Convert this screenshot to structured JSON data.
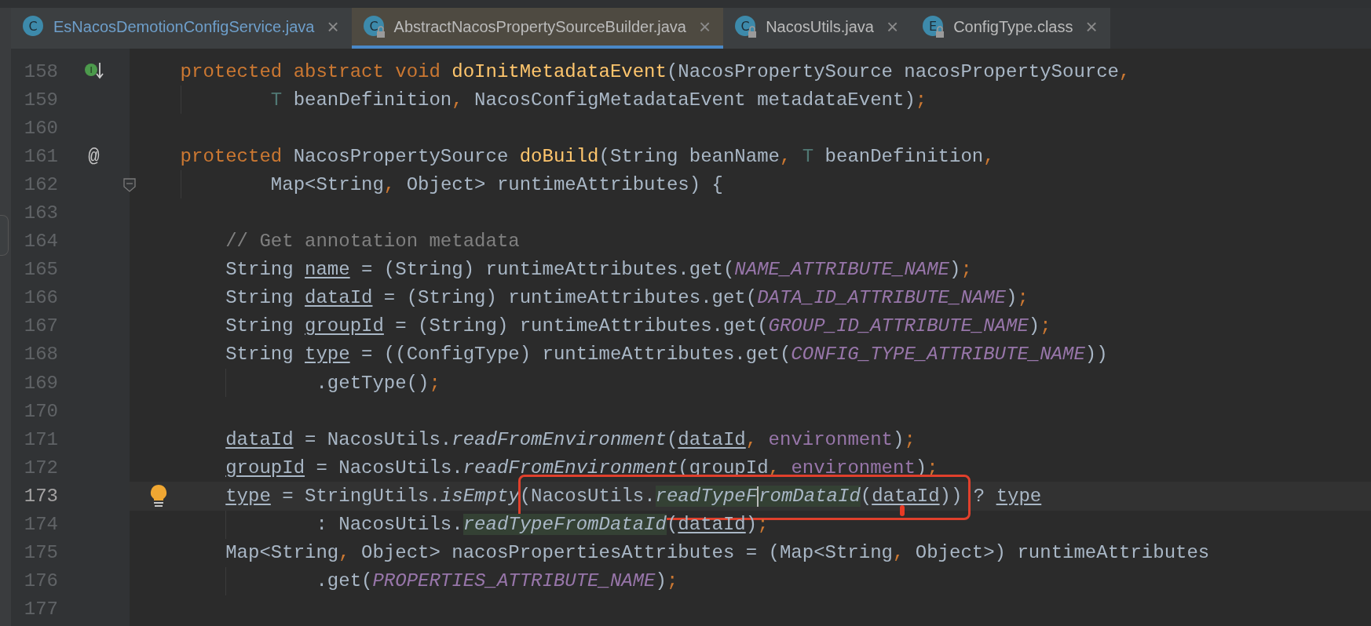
{
  "tabs": [
    {
      "icon_letter": "C",
      "label": "EsNacosDemotionConfigService.java",
      "close": "×",
      "locked": false,
      "selected": false,
      "color": "#6e9fcb"
    },
    {
      "icon_letter": "C",
      "label": "AbstractNacosPropertySourceBuilder.java",
      "close": "×",
      "locked": true,
      "selected": true,
      "color": "#bbbbbb"
    },
    {
      "icon_letter": "C",
      "label": "NacosUtils.java",
      "close": "×",
      "locked": true,
      "selected": false,
      "color": "#bbbbbb"
    },
    {
      "icon_letter": "E",
      "label": "ConfigType.class",
      "close": "×",
      "locked": true,
      "selected": false,
      "color": "#bbbbbb"
    }
  ],
  "lines": [
    {
      "number": "158",
      "current": false,
      "annotated": false,
      "kind": "member",
      "gutter": {
        "kind": "implements",
        "letter": "I"
      },
      "tokens": [
        {
          "t": "protected abstract void ",
          "kind": "kw"
        },
        {
          "t": "doInitMetadataEvent",
          "kind": "fn"
        },
        {
          "t": "(NacosPropertySource nacosPropertySource",
          "kind": "plain"
        },
        {
          "t": ",",
          "kind": "punct"
        }
      ]
    },
    {
      "number": "159",
      "current": false,
      "annotated": false,
      "kind": "member_wrap",
      "tokens": [
        {
          "t": "T",
          "kind": "tparam"
        },
        {
          "t": " beanDefinition",
          "kind": "plain"
        },
        {
          "t": ", ",
          "kind": "punct"
        },
        {
          "t": "NacosConfigMetadataEvent metadataEvent)",
          "kind": "plain"
        },
        {
          "t": ";",
          "kind": "punct"
        }
      ]
    },
    {
      "number": "160",
      "current": false,
      "annotated": false,
      "kind": "blank"
    },
    {
      "number": "161",
      "current": false,
      "annotated": false,
      "kind": "member",
      "gutter": {
        "kind": "annotation",
        "symbol": "@"
      },
      "tokens": [
        {
          "t": "protected ",
          "kind": "kw"
        },
        {
          "t": "NacosPropertySource ",
          "kind": "plain"
        },
        {
          "t": "doBuild",
          "kind": "fn"
        },
        {
          "t": "(String beanName",
          "kind": "plain"
        },
        {
          "t": ", ",
          "kind": "punct"
        },
        {
          "t": "T",
          "kind": "tparam"
        },
        {
          "t": " beanDefinition",
          "kind": "plain"
        },
        {
          "t": ",",
          "kind": "punct"
        }
      ]
    },
    {
      "number": "162",
      "current": false,
      "annotated": false,
      "kind": "member_wrap",
      "gutter": {
        "kind": "fold"
      },
      "tokens": [
        {
          "t": "Map<String",
          "kind": "plain"
        },
        {
          "t": ", ",
          "kind": "punct"
        },
        {
          "t": "Object> runtimeAttributes) {",
          "kind": "plain"
        }
      ]
    },
    {
      "number": "163",
      "current": false,
      "annotated": false,
      "kind": "blank"
    },
    {
      "number": "164",
      "current": false,
      "annotated": false,
      "kind": "body",
      "tokens": [
        {
          "t": "// Get annotation metadata",
          "kind": "comment"
        }
      ]
    },
    {
      "number": "165",
      "current": false,
      "annotated": false,
      "kind": "body",
      "tokens": [
        {
          "t": "String ",
          "kind": "plain"
        },
        {
          "t": "name",
          "kind": "uvar"
        },
        {
          "t": " = (String) runtimeAttributes.get(",
          "kind": "plain"
        },
        {
          "t": "NAME_ATTRIBUTE_NAME",
          "kind": "const"
        },
        {
          "t": ")",
          "kind": "plain"
        },
        {
          "t": ";",
          "kind": "punct"
        }
      ]
    },
    {
      "number": "166",
      "current": false,
      "annotated": false,
      "kind": "body",
      "tokens": [
        {
          "t": "String ",
          "kind": "plain"
        },
        {
          "t": "dataId",
          "kind": "uvar"
        },
        {
          "t": " = (String) runtimeAttributes.get(",
          "kind": "plain"
        },
        {
          "t": "DATA_ID_ATTRIBUTE_NAME",
          "kind": "const"
        },
        {
          "t": ")",
          "kind": "plain"
        },
        {
          "t": ";",
          "kind": "punct"
        }
      ]
    },
    {
      "number": "167",
      "current": false,
      "annotated": false,
      "kind": "body",
      "tokens": [
        {
          "t": "String ",
          "kind": "plain"
        },
        {
          "t": "groupId",
          "kind": "uvar"
        },
        {
          "t": " = (String) runtimeAttributes.get(",
          "kind": "plain"
        },
        {
          "t": "GROUP_ID_ATTRIBUTE_NAME",
          "kind": "const"
        },
        {
          "t": ")",
          "kind": "plain"
        },
        {
          "t": ";",
          "kind": "punct"
        }
      ]
    },
    {
      "number": "168",
      "current": false,
      "annotated": false,
      "kind": "body",
      "tokens": [
        {
          "t": "String ",
          "kind": "plain"
        },
        {
          "t": "type",
          "kind": "uvar"
        },
        {
          "t": " = ((ConfigType) runtimeAttributes.get(",
          "kind": "plain"
        },
        {
          "t": "CONFIG_TYPE_ATTRIBUTE_NAME",
          "kind": "const"
        },
        {
          "t": "))",
          "kind": "plain"
        }
      ]
    },
    {
      "number": "169",
      "current": false,
      "annotated": false,
      "kind": "body_wrap",
      "tokens": [
        {
          "t": ".getType()",
          "kind": "plain"
        },
        {
          "t": ";",
          "kind": "punct"
        }
      ]
    },
    {
      "number": "170",
      "current": false,
      "annotated": false,
      "kind": "blank"
    },
    {
      "number": "171",
      "current": false,
      "annotated": false,
      "kind": "body",
      "tokens": [
        {
          "t": "dataId",
          "kind": "uvar"
        },
        {
          "t": " = NacosUtils.",
          "kind": "plain"
        },
        {
          "t": "readFromEnvironment",
          "kind": "static"
        },
        {
          "t": "(",
          "kind": "plain"
        },
        {
          "t": "dataId",
          "kind": "uvar"
        },
        {
          "t": ", ",
          "kind": "punct"
        },
        {
          "t": "environment",
          "kind": "field"
        },
        {
          "t": ")",
          "kind": "plain"
        },
        {
          "t": ";",
          "kind": "punct"
        }
      ]
    },
    {
      "number": "172",
      "current": false,
      "annotated": false,
      "kind": "body",
      "tokens": [
        {
          "t": "groupId",
          "kind": "uvar"
        },
        {
          "t": " = NacosUtils.",
          "kind": "plain"
        },
        {
          "t": "readFromEnvironment",
          "kind": "static"
        },
        {
          "t": "(",
          "kind": "plain"
        },
        {
          "t": "groupId",
          "kind": "uvar"
        },
        {
          "t": ", ",
          "kind": "punct"
        },
        {
          "t": "environment",
          "kind": "field"
        },
        {
          "t": ")",
          "kind": "plain"
        },
        {
          "t": ";",
          "kind": "punct"
        }
      ]
    },
    {
      "number": "173",
      "current": true,
      "annotated": true,
      "kind": "body",
      "gutter": {
        "kind": "bulb"
      },
      "tokens": [
        {
          "t": "type",
          "kind": "uvar"
        },
        {
          "t": " = StringUtils.",
          "kind": "plain"
        },
        {
          "t": "isEmpty",
          "kind": "static"
        },
        {
          "t": "(NacosUtils.",
          "kind": "plain"
        },
        {
          "t": "readTypeF",
          "kind": "usage"
        },
        {
          "kind": "caret"
        },
        {
          "t": "romDataId",
          "kind": "usage"
        },
        {
          "t": "(",
          "kind": "plain"
        },
        {
          "t": "dataId",
          "kind": "uvar"
        },
        {
          "t": ")) ? ",
          "kind": "plain"
        },
        {
          "t": "type",
          "kind": "uvar"
        }
      ]
    },
    {
      "number": "174",
      "current": false,
      "annotated": false,
      "kind": "body_wrap",
      "tokens": [
        {
          "t": ": NacosUtils.",
          "kind": "plain"
        },
        {
          "t": "readTypeFromDataId",
          "kind": "usage"
        },
        {
          "t": "(",
          "kind": "plain"
        },
        {
          "t": "dataId",
          "kind": "uvar"
        },
        {
          "t": ")",
          "kind": "plain"
        },
        {
          "t": ";",
          "kind": "punct"
        }
      ]
    },
    {
      "number": "175",
      "current": false,
      "annotated": false,
      "kind": "body",
      "tokens": [
        {
          "t": "Map<String",
          "kind": "plain"
        },
        {
          "t": ", ",
          "kind": "punct"
        },
        {
          "t": "Object> nacosPropertiesAttributes = (Map<String",
          "kind": "plain"
        },
        {
          "t": ", ",
          "kind": "punct"
        },
        {
          "t": "Object>) runtimeAttributes",
          "kind": "plain"
        }
      ]
    },
    {
      "number": "176",
      "current": false,
      "annotated": false,
      "kind": "body_wrap",
      "tokens": [
        {
          "t": ".get(",
          "kind": "plain"
        },
        {
          "t": "PROPERTIES_ATTRIBUTE_NAME",
          "kind": "const"
        },
        {
          "t": ")",
          "kind": "plain"
        },
        {
          "t": ";",
          "kind": "punct"
        }
      ]
    },
    {
      "number": "177",
      "current": false,
      "annotated": false,
      "kind": "blank"
    }
  ]
}
